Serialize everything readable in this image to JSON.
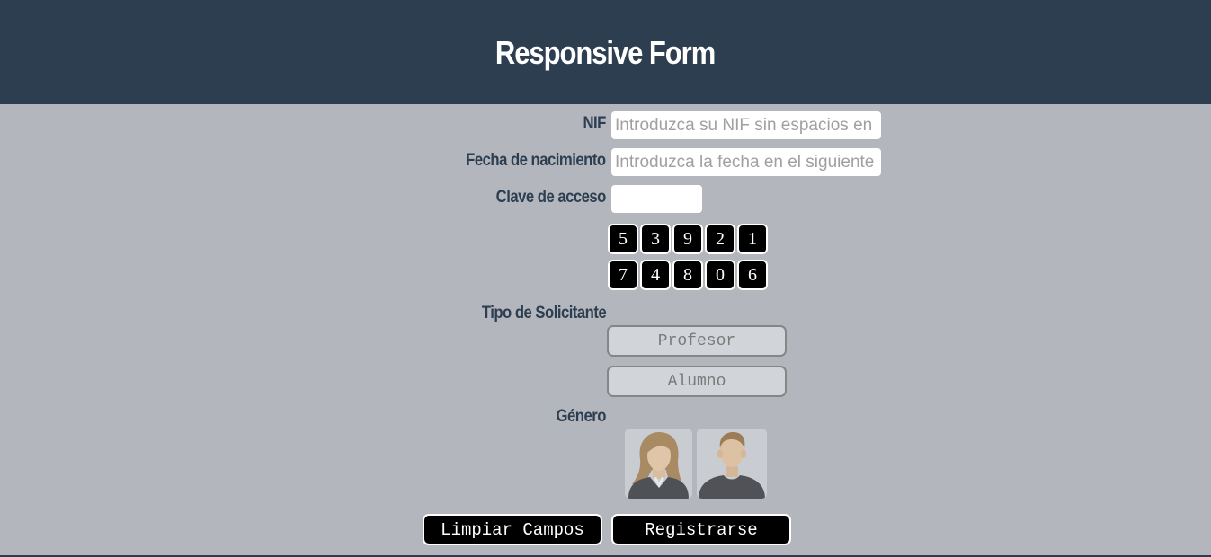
{
  "header": {
    "title": "Responsive Form"
  },
  "form": {
    "nif": {
      "label": "NIF",
      "placeholder": "Introduzca su NIF sin espacios en blanco",
      "value": ""
    },
    "birthdate": {
      "label": "Fecha de nacimiento",
      "placeholder": "Introduzca la fecha en el siguiente formato",
      "value": ""
    },
    "access_key": {
      "label": "Clave de acceso",
      "value": ""
    },
    "keypad": {
      "row1": [
        "5",
        "3",
        "9",
        "2",
        "1"
      ],
      "row2": [
        "7",
        "4",
        "8",
        "0",
        "6"
      ]
    },
    "applicant_type": {
      "label": "Tipo de Solicitante",
      "options": [
        "Profesor",
        "Alumno"
      ]
    },
    "gender": {
      "label": "Género",
      "options": [
        {
          "icon": "female-avatar-icon"
        },
        {
          "icon": "male-avatar-icon"
        }
      ]
    },
    "actions": {
      "clear_label": "Limpiar Campos",
      "submit_label": "Registrarse"
    }
  },
  "colors": {
    "header_bg": "#2e3e51",
    "page_bg": "#b3b7bd",
    "label_text": "#2e3e51",
    "key_bg": "#000000"
  }
}
